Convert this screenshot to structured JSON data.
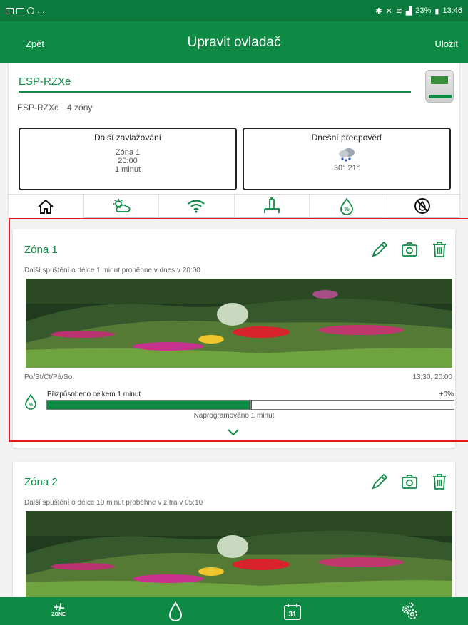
{
  "status_bar": {
    "battery": "23%",
    "time": "13:46"
  },
  "header": {
    "back_label": "Zpět",
    "title": "Upravit ovladač",
    "save_label": "Uložit"
  },
  "controller": {
    "name": "ESP-RZXe",
    "model": "ESP-RZXe",
    "zones": "4 zóny"
  },
  "next_watering": {
    "title": "Další zavlažování",
    "zone": "Zóna 1",
    "time": "20:00",
    "duration": "1 minut"
  },
  "forecast": {
    "title": "Dnešní předpověď",
    "temps": "30° 21°"
  },
  "tabs": [
    {
      "icon": "home-icon"
    },
    {
      "icon": "weather-icon"
    },
    {
      "icon": "wifi-icon"
    },
    {
      "icon": "sensor-icon"
    },
    {
      "icon": "seasonal-adjust-icon"
    },
    {
      "icon": "rain-delay-icon"
    }
  ],
  "zones": [
    {
      "name": "Zóna 1",
      "next_run": "Další spuštění o délce 1 minut proběhne v dnes v 20:00",
      "days": "Po/St/Čt/Pá/So",
      "times": "13:30, 20:00",
      "adjusted_label": "Přizpůsobeno celkem  1 minut",
      "adjust_percent": "+0%",
      "bar_fill_fraction": 0.5,
      "programmed_label": "Naprogramováno  1 minut"
    },
    {
      "name": "Zóna 2",
      "next_run": "Další spuštění o délce 10 minut proběhne v zítra v 05:10"
    }
  ],
  "bottom_nav": {
    "zone_label": "ZONE",
    "calendar_day": "31"
  },
  "colors": {
    "primary": "#0e8a44",
    "status_bar": "#0c7a3c",
    "highlight": "#e01b1b"
  }
}
